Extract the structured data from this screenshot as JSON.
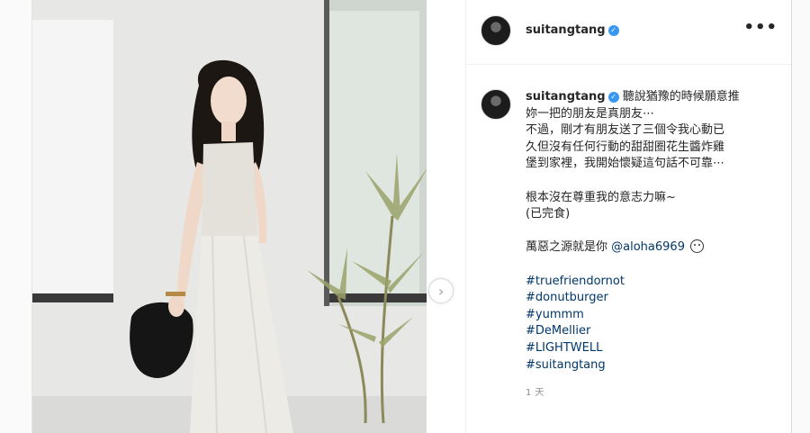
{
  "post": {
    "username": "suitangtang",
    "more_label": "•••",
    "next_label": "›",
    "caption": {
      "lines": [
        "聽說猶豫的時候願意推",
        "妳一把的朋友是真朋友⋯",
        "不過，剛才有朋友送了三個令我心動已",
        "久但沒有任何行動的甜甜圈花生醬炸雞",
        "堡到家裡，我開始懷疑這句話不可靠⋯"
      ],
      "lines2": [
        "根本沒在尊重我的意志力嘛~",
        "(已完食)"
      ],
      "blame_text": "萬惡之源就是你 ",
      "mention": "@aloha6969",
      "hashtags": [
        "#truefriendornot",
        "#donutburger",
        "#yummm",
        "#DeMellier",
        "#LIGHTWELL",
        "#suitangtang"
      ]
    },
    "timestamp": "1 天"
  },
  "colors": {
    "link": "#00376b",
    "verified": "#3897f0",
    "muted": "#8e8e8e"
  },
  "icons": [
    "verified-badge-icon",
    "more-options-icon",
    "next-arrow-icon",
    "emoji-icon"
  ]
}
